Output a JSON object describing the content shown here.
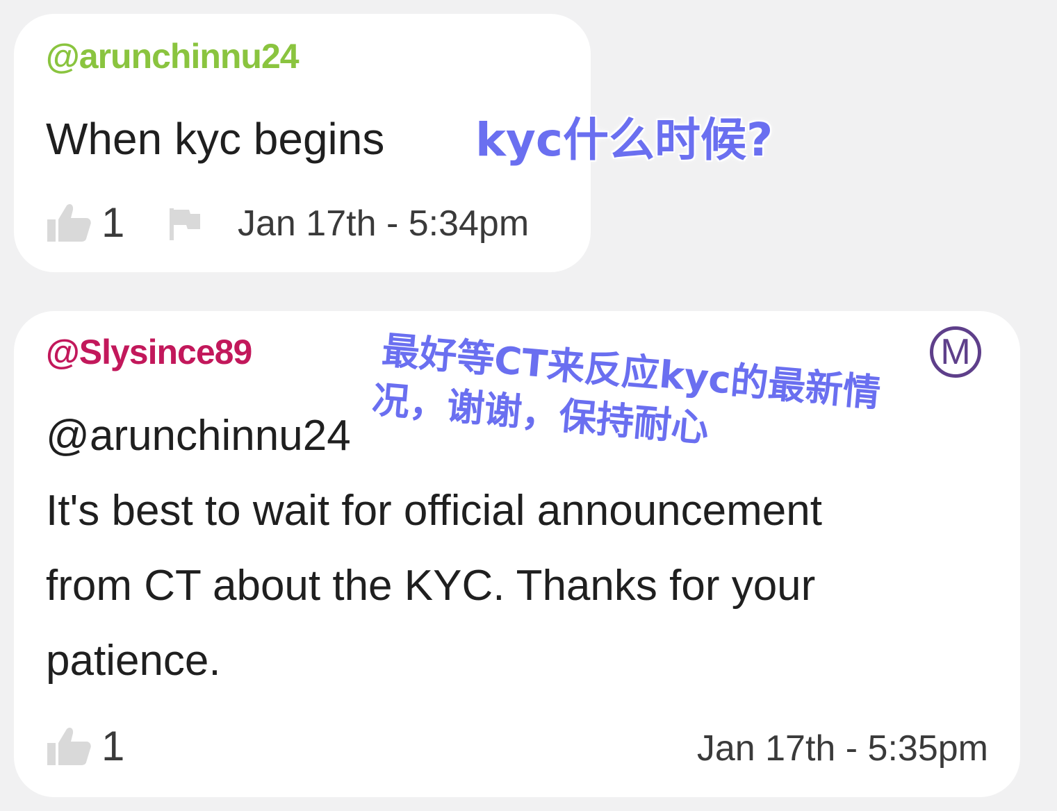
{
  "comments": [
    {
      "handle": "@arunchinnu24",
      "handle_color": "#8ac43f",
      "text": "When kyc begins",
      "likes": "1",
      "timestamp": "Jan 17th - 5:34pm",
      "icons": [
        "thumbs-up-icon",
        "flag-icon"
      ]
    },
    {
      "handle": "@Slysince89",
      "handle_color": "#c2185b",
      "badge": "M",
      "mention": "@arunchinnu24",
      "lines": [
        "It's best to wait for official announcement",
        "from CT about the KYC. Thanks for your",
        "patience."
      ],
      "likes": "1",
      "timestamp": "Jan 17th - 5:35pm",
      "icons": [
        "thumbs-up-icon",
        "moderator-badge-icon"
      ]
    }
  ],
  "annotations": {
    "question": "kyc什么时候?",
    "answer_line1": "最好等CT来反应kyc的最新情",
    "answer_line2": "况，谢谢，保持耐心",
    "color": "#6a6ff0"
  }
}
